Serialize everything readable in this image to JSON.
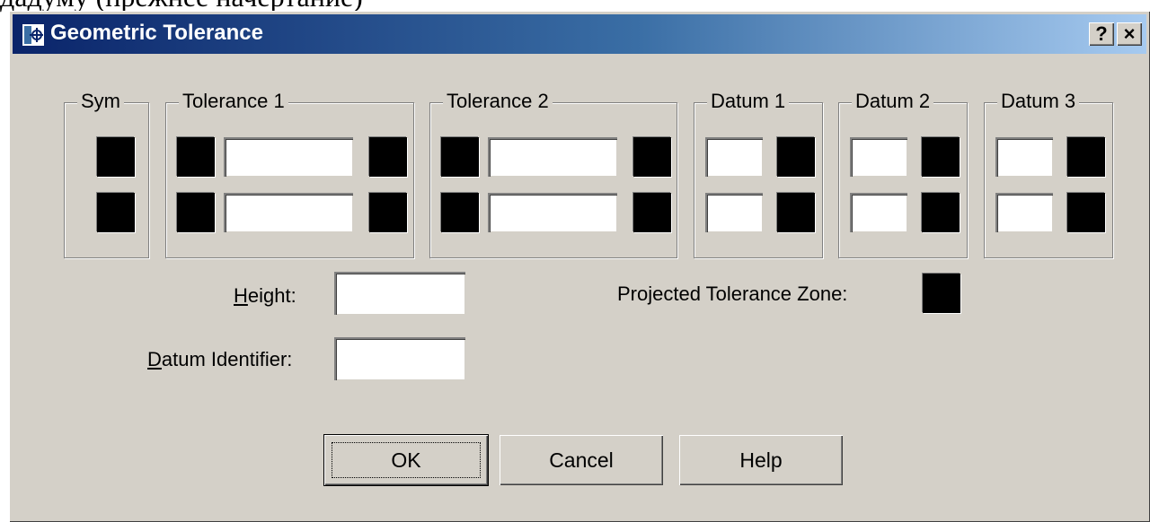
{
  "page": {
    "clipped_text": "дадуму (прежнее начертание)"
  },
  "window": {
    "title": "Geometric Tolerance",
    "icon": "geometric-tolerance-icon"
  },
  "titlebar_buttons": {
    "help": "?",
    "close": "×"
  },
  "groups": {
    "sym": "Sym",
    "tol1": "Tolerance 1",
    "tol2": "Tolerance 2",
    "datum1": "Datum 1",
    "datum2": "Datum 2",
    "datum3": "Datum 3"
  },
  "fields": {
    "height": {
      "label_first": "H",
      "label_rest": "eight:",
      "value": ""
    },
    "datum_identifier": {
      "label_first": "D",
      "label_rest": "atum Identifier:",
      "value": ""
    },
    "projected_tolerance_zone": {
      "label": "Projected Tolerance Zone:"
    }
  },
  "buttons": {
    "ok": "OK",
    "cancel": "Cancel",
    "help": "Help"
  },
  "colors": {
    "dialog": "#d4d0c8",
    "title_start": "#0a246a",
    "title_end": "#a6caf0",
    "swatch": "#000000"
  }
}
